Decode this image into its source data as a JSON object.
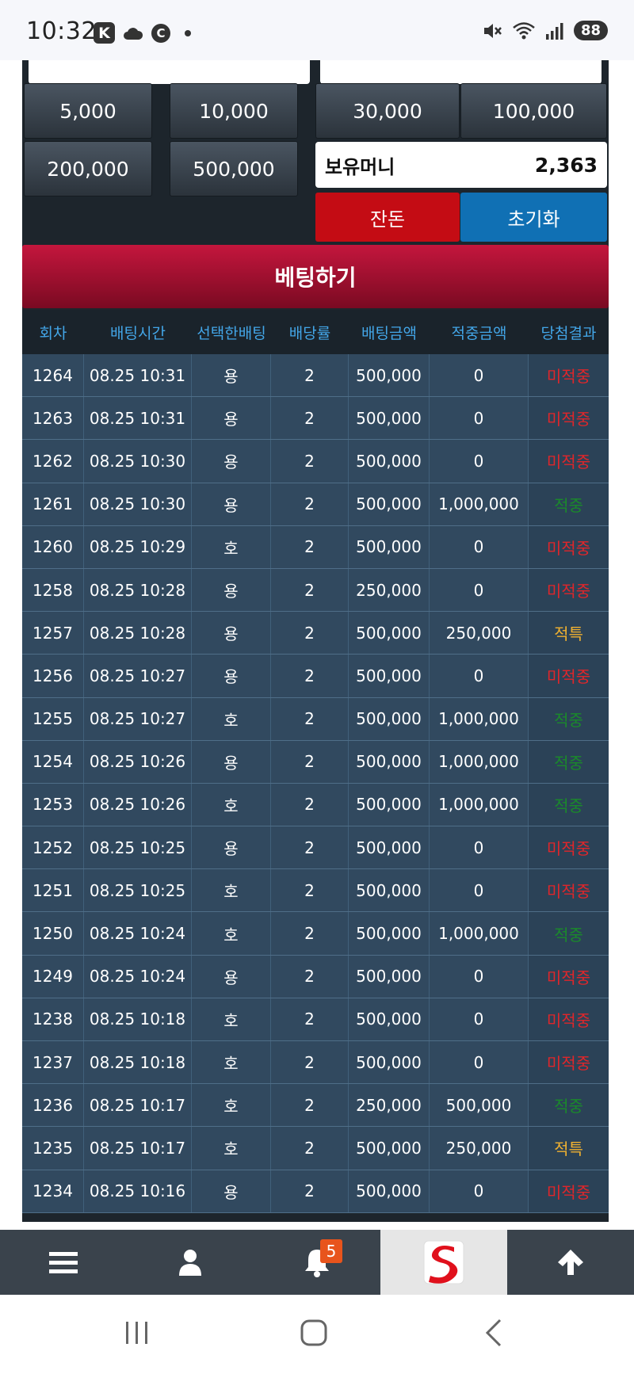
{
  "status_bar": {
    "time": "10:32",
    "k_badge": "K",
    "c_badge": "C",
    "battery": "88",
    "icons": [
      "cloud-icon",
      "mute-icon",
      "wifi-icon",
      "signal-icon"
    ]
  },
  "chips": [
    "5,000",
    "10,000",
    "30,000",
    "100,000",
    "200,000",
    "500,000"
  ],
  "balance": {
    "label": "보유머니",
    "value": "2,363"
  },
  "buttons": {
    "remaining": "잔돈",
    "reset": "초기화",
    "bet": "베팅하기"
  },
  "colors": {
    "remaining_button": "#c40c14",
    "reset_button": "#1070b4",
    "bet_button": "#a5122f",
    "header_text": "#43a6e8",
    "lose": "#e0262a",
    "win": "#1a8a2a",
    "special": "#f0b130"
  },
  "table": {
    "headers": [
      "회차",
      "배팅시간",
      "선택한배팅",
      "배당률",
      "배팅금액",
      "적중금액",
      "당첨결과"
    ],
    "rows": [
      [
        "1264",
        "08.25 10:31",
        "용",
        "2",
        "500,000",
        "0",
        "미적중"
      ],
      [
        "1263",
        "08.25 10:31",
        "용",
        "2",
        "500,000",
        "0",
        "미적중"
      ],
      [
        "1262",
        "08.25 10:30",
        "용",
        "2",
        "500,000",
        "0",
        "미적중"
      ],
      [
        "1261",
        "08.25 10:30",
        "용",
        "2",
        "500,000",
        "1,000,000",
        "적중"
      ],
      [
        "1260",
        "08.25 10:29",
        "호",
        "2",
        "500,000",
        "0",
        "미적중"
      ],
      [
        "1258",
        "08.25 10:28",
        "용",
        "2",
        "250,000",
        "0",
        "미적중"
      ],
      [
        "1257",
        "08.25 10:28",
        "용",
        "2",
        "500,000",
        "250,000",
        "적특"
      ],
      [
        "1256",
        "08.25 10:27",
        "용",
        "2",
        "500,000",
        "0",
        "미적중"
      ],
      [
        "1255",
        "08.25 10:27",
        "호",
        "2",
        "500,000",
        "1,000,000",
        "적중"
      ],
      [
        "1254",
        "08.25 10:26",
        "용",
        "2",
        "500,000",
        "1,000,000",
        "적중"
      ],
      [
        "1253",
        "08.25 10:26",
        "호",
        "2",
        "500,000",
        "1,000,000",
        "적중"
      ],
      [
        "1252",
        "08.25 10:25",
        "용",
        "2",
        "500,000",
        "0",
        "미적중"
      ],
      [
        "1251",
        "08.25 10:25",
        "호",
        "2",
        "500,000",
        "0",
        "미적중"
      ],
      [
        "1250",
        "08.25 10:24",
        "호",
        "2",
        "500,000",
        "1,000,000",
        "적중"
      ],
      [
        "1249",
        "08.25 10:24",
        "용",
        "2",
        "500,000",
        "0",
        "미적중"
      ],
      [
        "1238",
        "08.25 10:18",
        "호",
        "2",
        "500,000",
        "0",
        "미적중"
      ],
      [
        "1237",
        "08.25 10:18",
        "호",
        "2",
        "500,000",
        "0",
        "미적중"
      ],
      [
        "1236",
        "08.25 10:17",
        "호",
        "2",
        "250,000",
        "500,000",
        "적중"
      ],
      [
        "1235",
        "08.25 10:17",
        "호",
        "2",
        "500,000",
        "250,000",
        "적특"
      ],
      [
        "1234",
        "08.25 10:16",
        "용",
        "2",
        "500,000",
        "0",
        "미적중"
      ]
    ]
  },
  "bottom_nav": {
    "items": [
      "menu-icon",
      "user-icon",
      "bell-icon",
      "brand-logo",
      "arrow-up-icon"
    ],
    "notification_count": "5"
  },
  "system_nav": [
    "recent-apps-icon",
    "home-icon",
    "back-icon"
  ]
}
